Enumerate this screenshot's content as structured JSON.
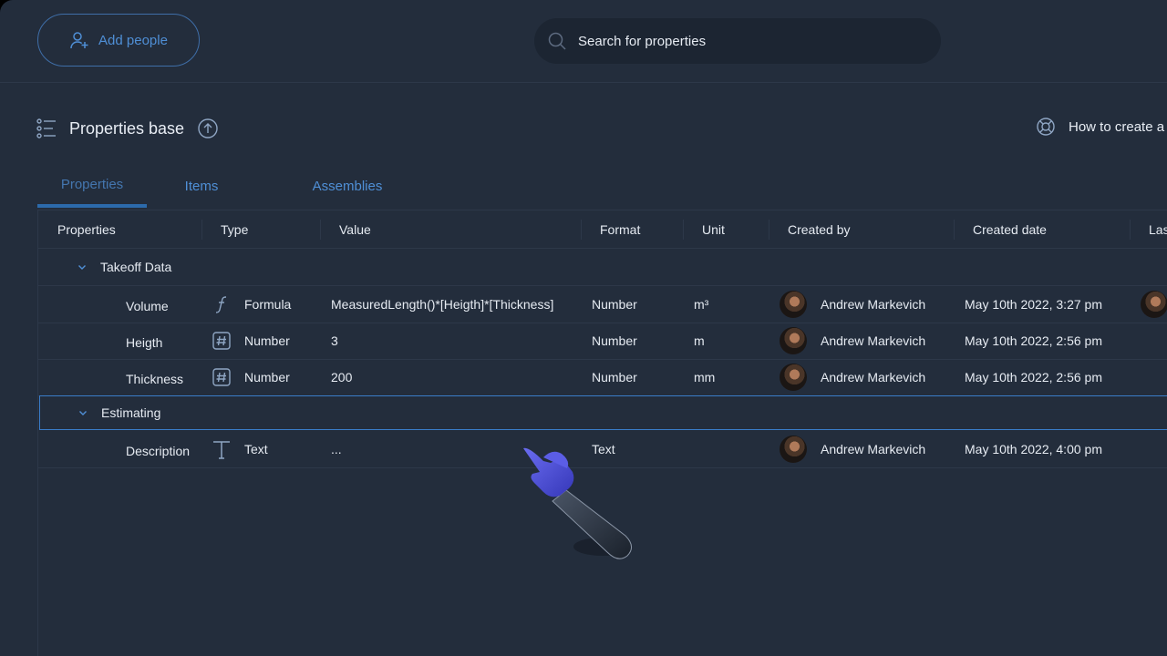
{
  "topbar": {
    "add_people_label": "Add people",
    "search_placeholder": "Search for properties"
  },
  "titlebar": {
    "title": "Properties base",
    "help_link": "How to create a"
  },
  "tabs": [
    {
      "label": "Properties",
      "active": true
    },
    {
      "label": "Items",
      "active": false
    },
    {
      "label": "Assemblies",
      "active": false
    }
  ],
  "columns": [
    "Properties",
    "Type",
    "Value",
    "Format",
    "Unit",
    "Created by",
    "Created date",
    "Last"
  ],
  "groups": [
    {
      "name": "Takeoff Data",
      "rows": [
        {
          "property": "Volume",
          "type_icon": "formula-icon",
          "type": "Formula",
          "value": "MeasuredLength()*[Heigth]*[Thickness]",
          "format": "Number",
          "unit": "m³",
          "created_by": "Andrew Markevich",
          "created_date": "May 10th 2022, 3:27 pm"
        },
        {
          "property": "Heigth",
          "type_icon": "number-icon",
          "type": "Number",
          "value": "3",
          "format": "Number",
          "unit": "m",
          "created_by": "Andrew Markevich",
          "created_date": "May 10th 2022, 2:56 pm"
        },
        {
          "property": "Thickness",
          "type_icon": "number-icon",
          "type": "Number",
          "value": "200",
          "format": "Number",
          "unit": "mm",
          "created_by": "Andrew Markevich",
          "created_date": "May 10th 2022, 2:56 pm"
        }
      ]
    },
    {
      "name": "Estimating",
      "rows": [
        {
          "property": "Description",
          "type_icon": "text-icon",
          "type": "Text",
          "value": "...",
          "format": "Text",
          "unit": "",
          "created_by": "Andrew Markevich",
          "created_date": "May 10th 2022, 4:00 pm"
        }
      ]
    }
  ],
  "colors": {
    "background": "#232d3c",
    "accent": "#4f8fd6",
    "border": "#2d3849",
    "selection": "#3a7dc9",
    "pointer": "#4d4fd8"
  }
}
